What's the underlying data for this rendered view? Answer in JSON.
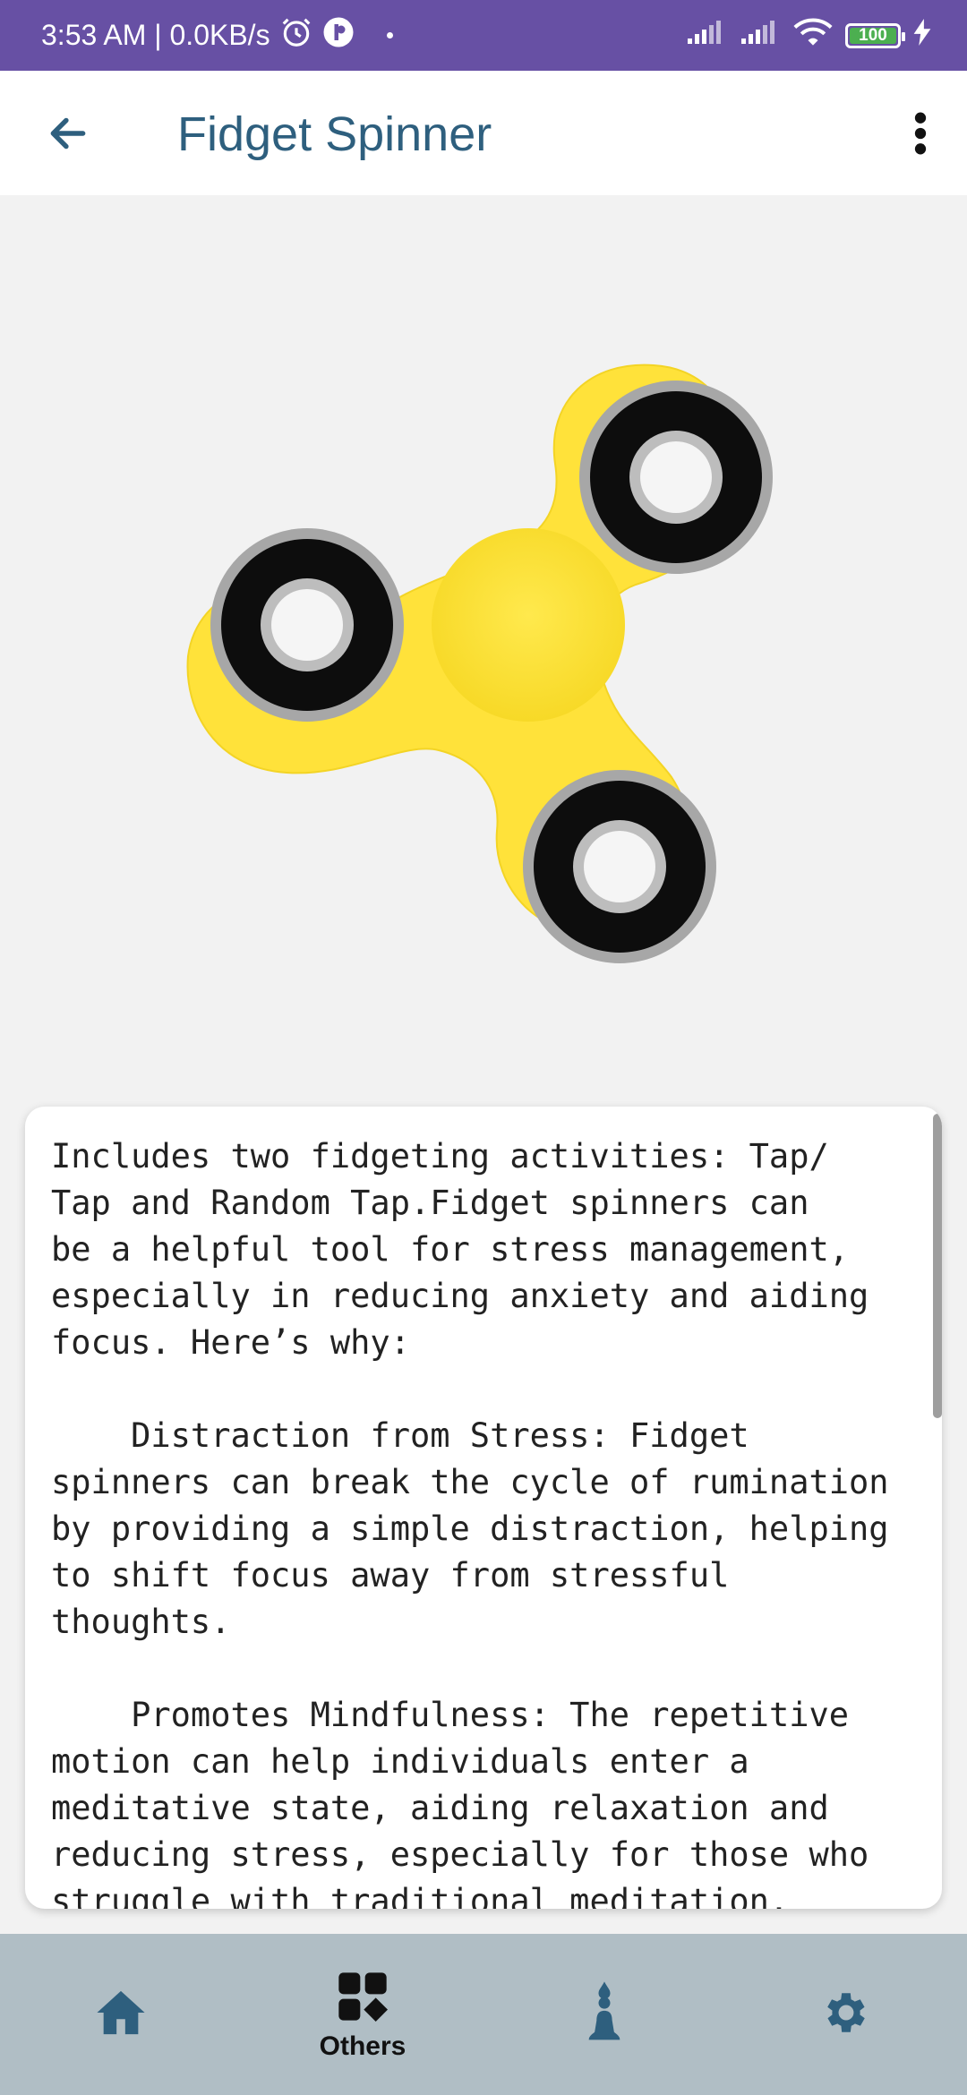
{
  "status_bar": {
    "time_info": "3:53 AM | 0.0KB/s",
    "battery": "100",
    "icons": [
      "alarm-icon",
      "app-icon",
      "signal-icon",
      "signal-icon",
      "wifi-icon",
      "battery-icon",
      "charging-icon"
    ]
  },
  "app_bar": {
    "title": "Fidget Spinner",
    "back_icon": "arrow-left-icon",
    "menu_icon": "more-vertical-icon"
  },
  "spinner": {
    "body_color": "#FFE23A",
    "bearing_color": "#111111"
  },
  "description": {
    "text": "Includes two fidgeting activities: Tap/\nTap and Random Tap.Fidget spinners can\nbe a helpful tool for stress management,\nespecially in reducing anxiety and aiding\nfocus. Here’s why:\n\n    Distraction from Stress: Fidget\nspinners can break the cycle of rumination\nby providing a simple distraction, helping\nto shift focus away from stressful\nthoughts.\n\n    Promotes Mindfulness: The repetitive\nmotion can help individuals enter a\nmeditative state, aiding relaxation and\nreducing stress, especially for those who\nstruggle with traditional meditation."
  },
  "bottom_nav": {
    "items": [
      {
        "icon": "home-icon",
        "label": ""
      },
      {
        "icon": "grid-icon",
        "label": "Others"
      },
      {
        "icon": "meditation-icon",
        "label": ""
      },
      {
        "icon": "gear-icon",
        "label": ""
      }
    ],
    "active_index": 1,
    "icon_color": "#2E5F7E",
    "active_color": "#111111"
  }
}
